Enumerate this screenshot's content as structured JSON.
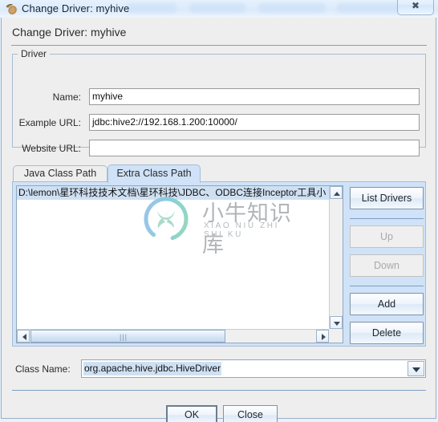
{
  "window": {
    "title": "Change Driver: myhive",
    "icon": "acorn-icon",
    "close_label": "✖"
  },
  "dialog": {
    "header": "Change Driver: myhive"
  },
  "driver_group": {
    "title": "Driver",
    "fields": [
      {
        "label": "Name:",
        "value": "myhive",
        "placeholder": ""
      },
      {
        "label": "Example URL:",
        "value": "jdbc:hive2://192.168.1.200:10000/",
        "placeholder": ""
      },
      {
        "label": "Website URL:",
        "value": "",
        "placeholder": ""
      }
    ]
  },
  "tabs": [
    {
      "label": "Java Class Path",
      "selected": false
    },
    {
      "label": "Extra Class Path",
      "selected": true
    }
  ],
  "class_path_list": {
    "items": [
      "D:\\lemon\\星环科技技术文档\\星环科技\\JDBC、ODBC连接Inceptor工具小"
    ],
    "selected_index": 0
  },
  "side_buttons": [
    {
      "label": "List Drivers",
      "enabled": true
    },
    {
      "label": "Up",
      "enabled": false
    },
    {
      "label": "Down",
      "enabled": false
    },
    {
      "label": "Add",
      "enabled": true
    },
    {
      "label": "Delete",
      "enabled": true
    }
  ],
  "class_name": {
    "label": "Class Name:",
    "value": "org.apache.hive.jdbc.HiveDriver",
    "arrow": "▼"
  },
  "footer_buttons": [
    {
      "label": "OK",
      "default": true
    },
    {
      "label": "Close",
      "default": false
    }
  ],
  "watermark": {
    "cn": "小牛知识库",
    "en": "XIAO NIU ZHI SHI KU"
  },
  "colors": {
    "dialog_bg": "#eeeeee",
    "tab_selected_bg": "#cfe2f7",
    "selection_bg": "#cfe0f2",
    "rule": "#7f9ec4",
    "border": "#a8bdd4"
  }
}
